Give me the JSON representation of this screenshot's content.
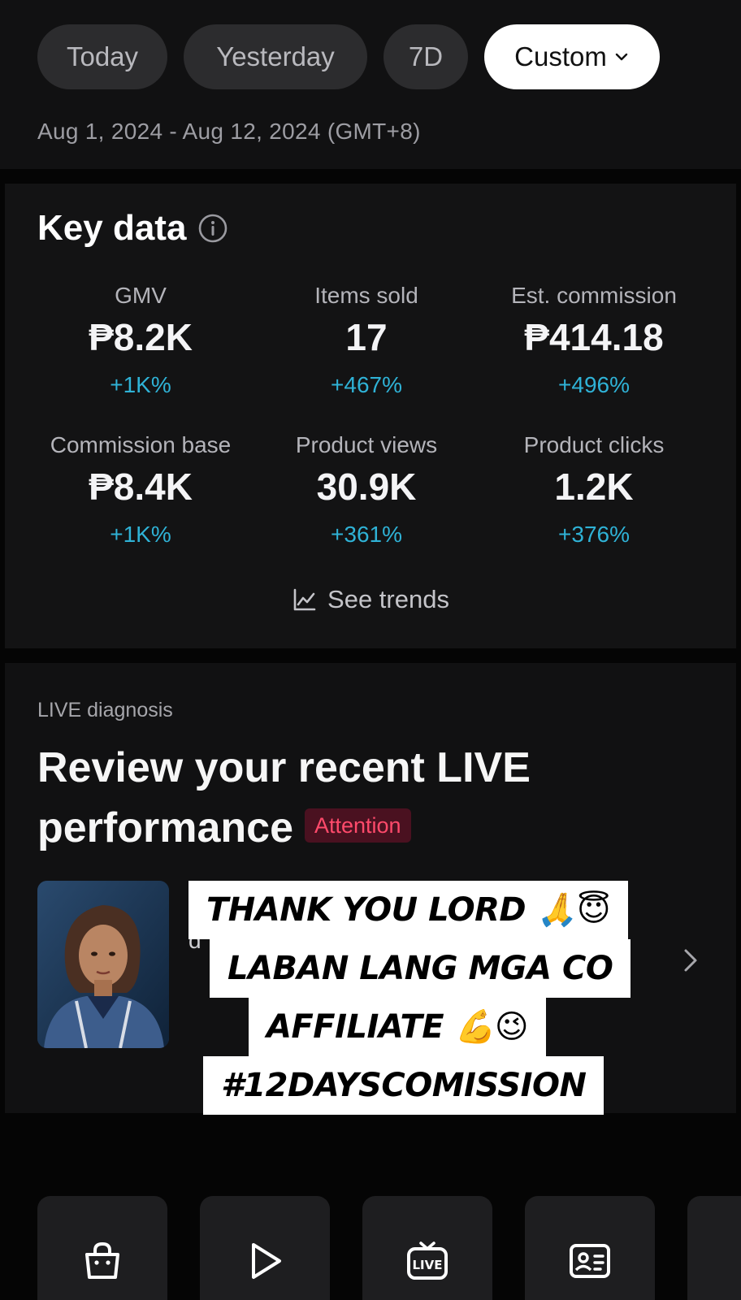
{
  "filters": {
    "chips": [
      {
        "label": "Today"
      },
      {
        "label": "Yesterday"
      },
      {
        "label": "7D"
      },
      {
        "label": "Custom"
      }
    ],
    "selected": "Custom",
    "date_range": "Aug 1, 2024 - Aug 12, 2024 (GMT+8)"
  },
  "key_data": {
    "title": "Key data",
    "metrics": [
      {
        "label": "GMV",
        "value": "₱8.2K",
        "delta": "+1K%"
      },
      {
        "label": "Items sold",
        "value": "17",
        "delta": "+467%"
      },
      {
        "label": "Est. commission",
        "value": "₱414.18",
        "delta": "+496%"
      },
      {
        "label": "Commission base",
        "value": "₱8.4K",
        "delta": "+1K%"
      },
      {
        "label": "Product views",
        "value": "30.9K",
        "delta": "+361%"
      },
      {
        "label": "Product clicks",
        "value": "1.2K",
        "delta": "+376%"
      }
    ],
    "trends_label": "See trends",
    "delta_color": "#2fb2d6"
  },
  "live": {
    "eyebrow": "LIVE diagnosis",
    "title": "Review your recent LIVE performance",
    "badge": "Attention",
    "partial_name": "d"
  },
  "caption_overlay": {
    "lines": [
      "THANK YOU LORD 🙏😇",
      "LABAN LANG MGA CO",
      "AFFILIATE 💪😉",
      "#12DAYSCOMISSION"
    ]
  },
  "tools": [
    {
      "icon": "shopping-bag-icon"
    },
    {
      "icon": "play-icon"
    },
    {
      "icon": "live-tv-icon"
    },
    {
      "icon": "id-card-icon"
    }
  ]
}
